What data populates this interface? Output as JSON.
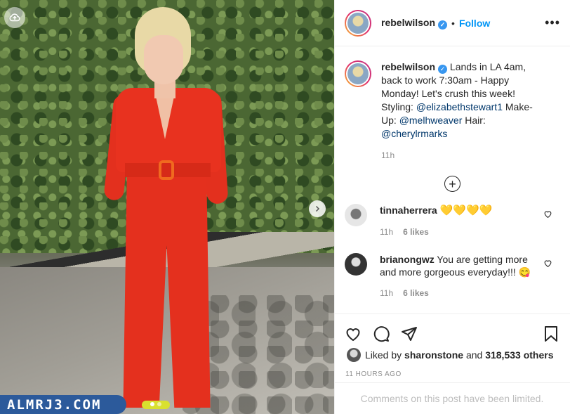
{
  "watermark": "ALMRJ3.COM",
  "post": {
    "username": "rebelwilson",
    "separator": "•",
    "follow_label": "Follow",
    "more_label": "•••"
  },
  "caption": {
    "username": "rebelwilson",
    "text_1": "Lands in LA 4am, back to work 7:30am - Happy Monday! Let's crush this week! Styling: ",
    "mention_1": "@elizabethstewart1",
    "text_2": " Make-Up: ",
    "mention_2": "@melhweaver",
    "text_3": " Hair: ",
    "mention_3": "@cherylrmarks",
    "time": "11h"
  },
  "load_more_label": "+",
  "comments": [
    {
      "user": "tinnaherrera",
      "text": "💛💛💛💛",
      "time": "11h",
      "likes": "6 likes"
    },
    {
      "user": "brianongwz",
      "text": "You are getting more and more gorgeous everyday!!! 😋",
      "time": "11h",
      "likes": "6 likes"
    }
  ],
  "likes": {
    "prefix": "Liked by ",
    "user": "sharonstone",
    "middle": " and ",
    "count": "318,533 others"
  },
  "posted_ago": "11 HOURS AGO",
  "comments_limited": "Comments on this post have been limited.",
  "colors": {
    "accent": "#0095f6",
    "verified": "#3897f0",
    "jumpsuit": "#e8321f"
  }
}
